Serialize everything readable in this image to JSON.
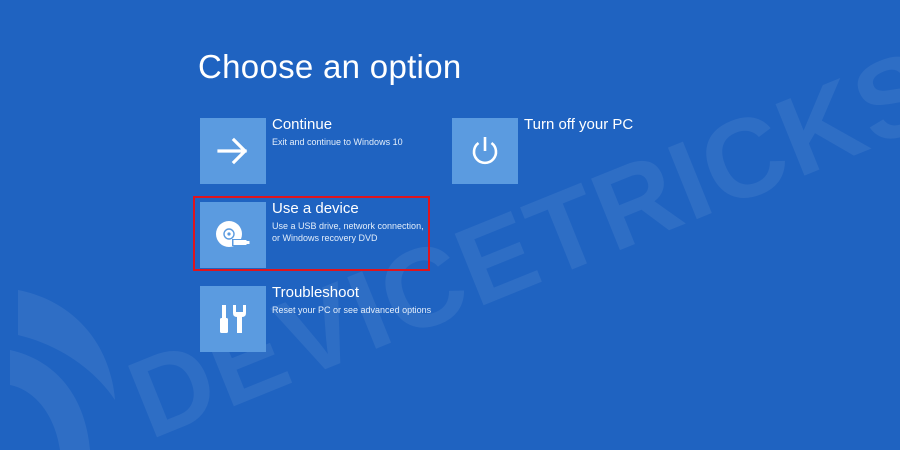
{
  "page": {
    "title": "Choose an option"
  },
  "options": {
    "continue": {
      "label": "Continue",
      "description": "Exit and continue to Windows 10",
      "icon": "arrow-right-icon"
    },
    "turn_off": {
      "label": "Turn off your PC",
      "icon": "power-icon"
    },
    "use_device": {
      "label": "Use a device",
      "description_line1": "Use a USB drive, network connection,",
      "description_line2": "or Windows recovery DVD",
      "icon": "disc-usb-icon"
    },
    "troubleshoot": {
      "label": "Troubleshoot",
      "description": "Reset your PC or see advanced options",
      "icon": "tools-icon"
    }
  },
  "colors": {
    "background": "#1f63c1",
    "tile": "#5b9be0",
    "highlight_border": "#e0141c"
  },
  "watermark": {
    "text": "DEVICETRICKS"
  }
}
